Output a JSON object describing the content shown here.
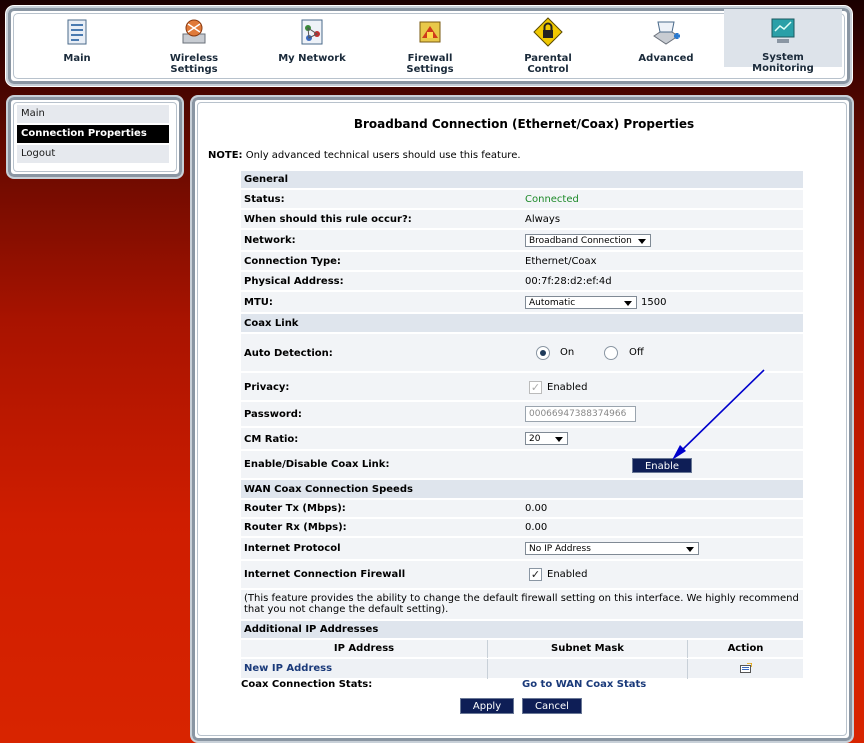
{
  "nav": {
    "items": [
      {
        "label": "Main",
        "icon": "main-icon"
      },
      {
        "label": "Wireless\nSettings",
        "icon": "wireless-icon"
      },
      {
        "label": "My Network",
        "icon": "network-icon"
      },
      {
        "label": "Firewall\nSettings",
        "icon": "firewall-icon"
      },
      {
        "label": "Parental\nControl",
        "icon": "lock-icon"
      },
      {
        "label": "Advanced",
        "icon": "advanced-icon"
      },
      {
        "label": "System\nMonitoring",
        "icon": "monitor-icon",
        "active": true
      }
    ]
  },
  "sidebar": {
    "items": [
      {
        "label": "Main"
      },
      {
        "label": "Connection Properties",
        "active": true
      },
      {
        "label": "Logout"
      }
    ]
  },
  "page": {
    "title": "Broadband Connection (Ethernet/Coax) Properties",
    "note_prefix": "NOTE:",
    "note_text": " Only advanced technical users should use this feature."
  },
  "general": {
    "heading": "General",
    "status_label": "Status:",
    "status_value": "Connected",
    "rule_label": "When should this rule occur?:",
    "rule_value": "Always",
    "network_label": "Network:",
    "network_value": "Broadband Connection",
    "conn_type_label": "Connection Type:",
    "conn_type_value": "Ethernet/Coax",
    "phys_label": "Physical Address:",
    "phys_value": "00:7f:28:d2:ef:4d",
    "mtu_label": "MTU:",
    "mtu_select": "Automatic",
    "mtu_value": "1500"
  },
  "coax": {
    "heading": "Coax Link",
    "auto_label": "Auto Detection:",
    "on_label": "On",
    "off_label": "Off",
    "privacy_label": "Privacy:",
    "privacy_value": "Enabled",
    "password_label": "Password:",
    "password_value": "00066947388374966",
    "cm_label": "CM Ratio:",
    "cm_value": "20",
    "enable_label": "Enable/Disable Coax Link:",
    "enable_button": "Enable"
  },
  "wan": {
    "heading": "WAN Coax Connection Speeds",
    "tx_label": "Router Tx (Mbps):",
    "tx_value": "0.00",
    "rx_label": "Router Rx (Mbps):",
    "rx_value": "0.00",
    "proto_label": "Internet Protocol",
    "proto_value": "No IP Address",
    "fw_label": "Internet Connection Firewall",
    "fw_value": "Enabled",
    "fw_note": "(This feature provides the ability to change the default firewall setting on this interface. We highly recommend that you not change the default setting)."
  },
  "additional": {
    "heading": "Additional IP Addresses",
    "col_ip": "IP Address",
    "col_mask": "Subnet Mask",
    "col_action": "Action",
    "new_ip": "New IP Address",
    "stats_label": "Coax Connection Stats:",
    "stats_link": "Go to WAN Coax Stats"
  },
  "buttons": {
    "apply": "Apply",
    "cancel": "Cancel"
  },
  "colors": {
    "accent_button": "#0e1e56",
    "status_connected": "#1e8a2a",
    "annotation_arrow": "#0000cc"
  }
}
